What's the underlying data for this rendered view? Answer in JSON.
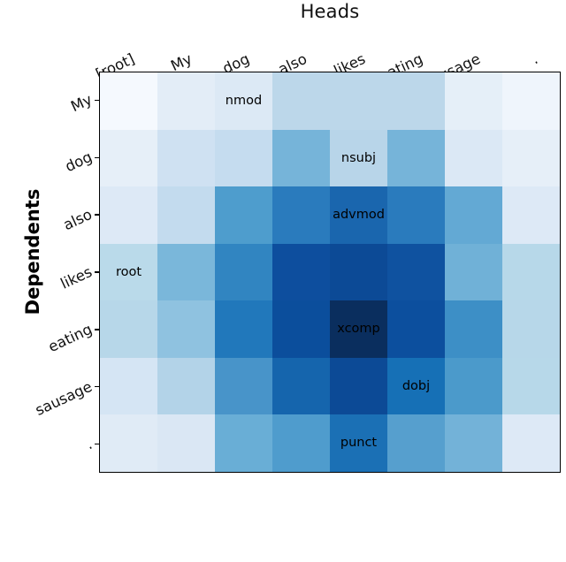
{
  "chart_data": {
    "type": "heatmap",
    "title": "Heads",
    "xlabel": "Heads",
    "ylabel": "Dependents",
    "x_categories": [
      "[root]",
      "My",
      "dog",
      "also",
      "likes",
      "eating",
      "sausage",
      "."
    ],
    "y_categories": [
      "My",
      "dog",
      "also",
      "likes",
      "eating",
      "sausage",
      "."
    ],
    "colormap": "Blues",
    "grid": false,
    "legend": "none",
    "vmin": 0.0,
    "vmax": 1.0,
    "values": [
      [
        0.02,
        0.1,
        0.14,
        0.22,
        0.22,
        0.22,
        0.09,
        0.04
      ],
      [
        0.09,
        0.16,
        0.2,
        0.36,
        0.21,
        0.36,
        0.11,
        0.09
      ],
      [
        0.1,
        0.18,
        0.38,
        0.52,
        0.62,
        0.52,
        0.3,
        0.1
      ],
      [
        0.2,
        0.33,
        0.47,
        0.76,
        0.8,
        0.74,
        0.33,
        0.19
      ],
      [
        0.21,
        0.3,
        0.55,
        0.72,
        0.97,
        0.74,
        0.52,
        0.2
      ],
      [
        0.12,
        0.22,
        0.42,
        0.62,
        0.73,
        0.58,
        0.4,
        0.19
      ],
      [
        0.08,
        0.11,
        0.33,
        0.38,
        0.57,
        0.37,
        0.31,
        0.11
      ]
    ],
    "cell_colors": [
      [
        "#f5f9fe",
        "#e3edf7",
        "#dce9f5",
        "#bcd7ea",
        "#bcd7ea",
        "#bcd7ea",
        "#e5eff8",
        "#eff5fc"
      ],
      [
        "#e6eff8",
        "#cfe1f2",
        "#c5dcef",
        "#76b4d9",
        "#b8d5e9",
        "#76b4d9",
        "#dbe8f5",
        "#e6eff8"
      ],
      [
        "#dde9f6",
        "#c3dbee",
        "#4e9dcd",
        "#2a7bbd",
        "#1a66ae",
        "#2a7bbd",
        "#63a9d4",
        "#dde9f6"
      ],
      [
        "#badaea",
        "#7ab7da",
        "#3185c1",
        "#0d4e9e",
        "#0c4a96",
        "#0f52a0",
        "#70b1d7",
        "#b7d8e9"
      ],
      [
        "#b7d7e9",
        "#8fc2e0",
        "#2178bb",
        "#0b4e9c",
        "#0a2e5e",
        "#0c4f9e",
        "#3d8fc6",
        "#b7d7e9"
      ],
      [
        "#d5e5f4",
        "#b3d3e8",
        "#4894c9",
        "#1565ad",
        "#0c4a96",
        "#1670b6",
        "#4b9acb",
        "#b7d8e9"
      ],
      [
        "#e0ebf6",
        "#dae7f4",
        "#69aed6",
        "#4f9ccd",
        "#1b70b5",
        "#569fce",
        "#73b2d8",
        "#dde9f6"
      ]
    ],
    "cell_labels": [
      [
        "",
        "",
        "nmod",
        "",
        "",
        "",
        "",
        ""
      ],
      [
        "",
        "",
        "",
        "",
        "nsubj",
        "",
        "",
        ""
      ],
      [
        "",
        "",
        "",
        "",
        "advmod",
        "",
        "",
        ""
      ],
      [
        "root",
        "",
        "",
        "",
        "",
        "",
        "",
        ""
      ],
      [
        "",
        "",
        "",
        "",
        "xcomp",
        "",
        "",
        ""
      ],
      [
        "",
        "",
        "",
        "",
        "",
        "dobj",
        "",
        ""
      ],
      [
        "",
        "",
        "",
        "",
        "punct",
        "",
        "",
        ""
      ]
    ]
  }
}
